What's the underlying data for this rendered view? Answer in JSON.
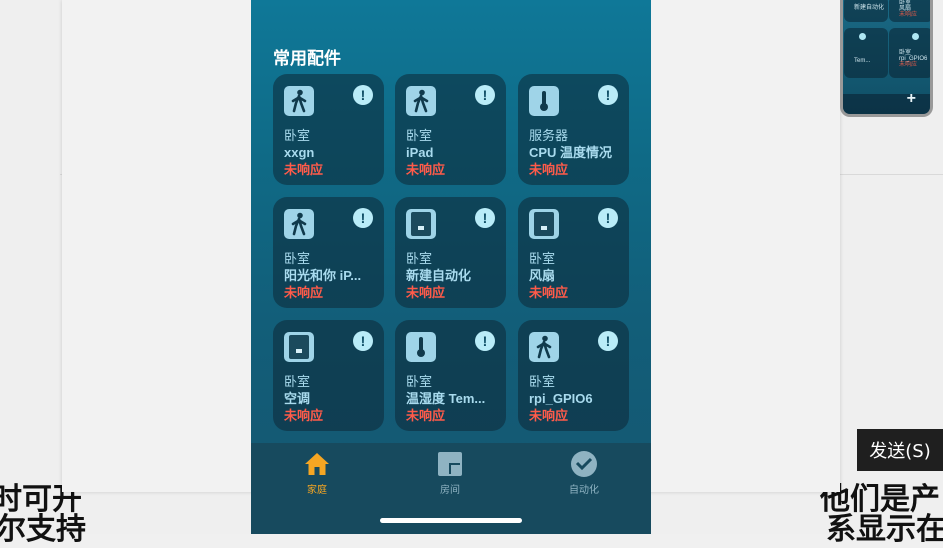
{
  "background": {
    "text_left_line1": "时可开",
    "text_left_line2": "尔支持",
    "text_right_line1": "他们是产",
    "text_right_line2": "系显示在"
  },
  "thumbnail": {
    "cells": [
      {
        "line1": "卧室",
        "line2": "风扇",
        "line3": "未响应"
      },
      {
        "line1": "卧室",
        "line2": "rpi_GPIO6",
        "line3": "未响应"
      },
      {
        "line1": "",
        "line2": "Tem...",
        "line3": ""
      }
    ],
    "top_left_text": "新建自动化",
    "plus": "+"
  },
  "section_title": "常用配件",
  "tiles": [
    {
      "icon": "walking-person-icon",
      "room": "卧室",
      "name": "xxgn",
      "status": "未响应"
    },
    {
      "icon": "walking-person-icon",
      "room": "卧室",
      "name": "iPad",
      "status": "未响应"
    },
    {
      "icon": "thermometer-icon",
      "room": "服务器",
      "name": "CPU 温度情况",
      "status": "未响应"
    },
    {
      "icon": "walking-person-icon",
      "room": "卧室",
      "name": "阳光和你 iP...",
      "status": "未响应"
    },
    {
      "icon": "switch-icon",
      "room": "卧室",
      "name": "新建自动化",
      "status": "未响应"
    },
    {
      "icon": "switch-icon",
      "room": "卧室",
      "name": "风扇",
      "status": "未响应"
    },
    {
      "icon": "switch-icon",
      "room": "卧室",
      "name": "空调",
      "status": "未响应"
    },
    {
      "icon": "thermometer-icon",
      "room": "卧室",
      "name": "温湿度 Tem...",
      "status": "未响应"
    },
    {
      "icon": "walking-person-icon",
      "room": "卧室",
      "name": "rpi_GPIO6",
      "status": "未响应"
    }
  ],
  "badge_symbol": "!",
  "tabs": [
    {
      "label": "家庭",
      "icon": "house-icon",
      "active": true
    },
    {
      "label": "房间",
      "icon": "rooms-icon",
      "active": false
    },
    {
      "label": "自动化",
      "icon": "clock-check-icon",
      "active": false
    }
  ],
  "send_button": "发送(S)",
  "colors": {
    "status_red": "#ff5b4a",
    "tab_active": "#f5a623",
    "phone_bg": "#0f6a86"
  }
}
